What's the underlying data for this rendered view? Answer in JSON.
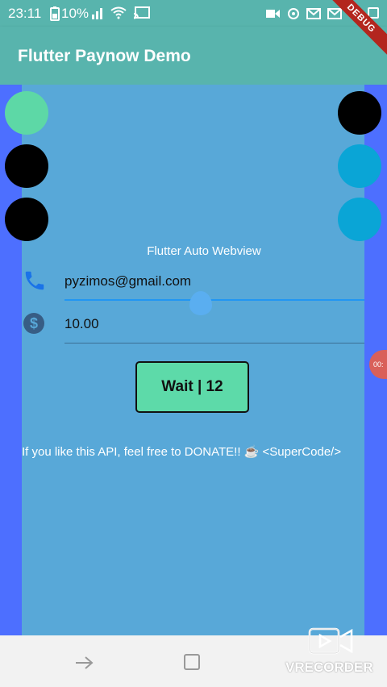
{
  "status_bar": {
    "time": "23:11",
    "battery_percent": "10%",
    "icons": [
      "battery-icon",
      "signal-icon",
      "wifi-icon",
      "cast-icon",
      "video-icon",
      "sync-icon",
      "gmail-icon",
      "gmail-icon",
      "whatsapp-icon",
      "checkbox-icon"
    ]
  },
  "app_bar": {
    "title": "Flutter Paynow Demo",
    "debug_banner": "DEBUG"
  },
  "colors": {
    "app_bar": "#58b4ad",
    "outer_background": "#4d6fff",
    "content_background": "#58a8d8",
    "button": "#5ddaa9",
    "circle_green": "#5dd8a6",
    "circle_black": "#000000",
    "circle_blue": "#0aa5d6"
  },
  "circles": {
    "left": [
      "green",
      "black",
      "black"
    ],
    "right": [
      "black",
      "blue",
      "blue"
    ]
  },
  "webview": {
    "label": "Flutter Auto Webview"
  },
  "form": {
    "email_value": "pyzimos@gmail.com",
    "amount_value": "10.00"
  },
  "wait_button": {
    "label": "Wait | 12"
  },
  "donate": {
    "text": "If you like this API, feel free to DONATE!! ☕ ",
    "code_tag": "<SuperCode/>"
  },
  "recording_bubble": {
    "text": "00:"
  },
  "watermark": {
    "text": "VRECORDER"
  }
}
